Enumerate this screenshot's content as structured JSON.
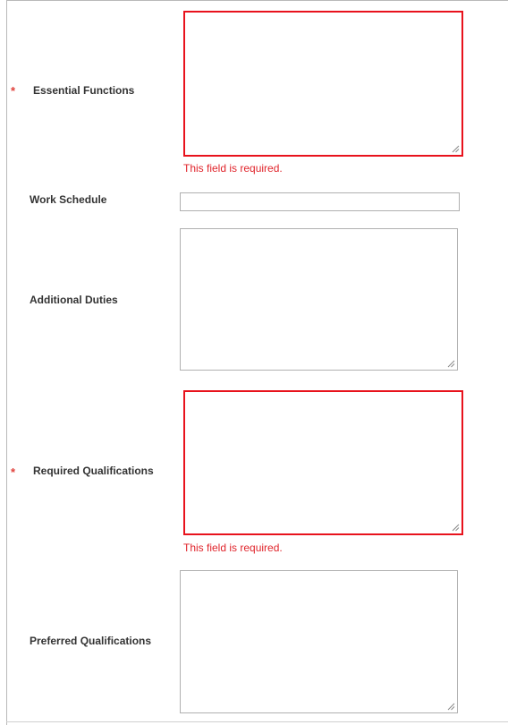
{
  "form": {
    "fields": [
      {
        "label": "Essential Functions",
        "required": true,
        "type": "textarea",
        "value": "",
        "error": "This field is required."
      },
      {
        "label": "Work Schedule",
        "required": false,
        "type": "text",
        "value": ""
      },
      {
        "label": "Additional Duties",
        "required": false,
        "type": "textarea",
        "value": ""
      },
      {
        "label": "Required Qualifications",
        "required": true,
        "type": "textarea",
        "value": "",
        "error": "This field is required."
      },
      {
        "label": "Preferred Qualifications",
        "required": false,
        "type": "textarea",
        "value": ""
      }
    ],
    "required_marker": "*"
  },
  "colors": {
    "error": "#e8121c",
    "required_marker": "#e0403a",
    "label": "#333333",
    "border": "#b0b0b0"
  }
}
